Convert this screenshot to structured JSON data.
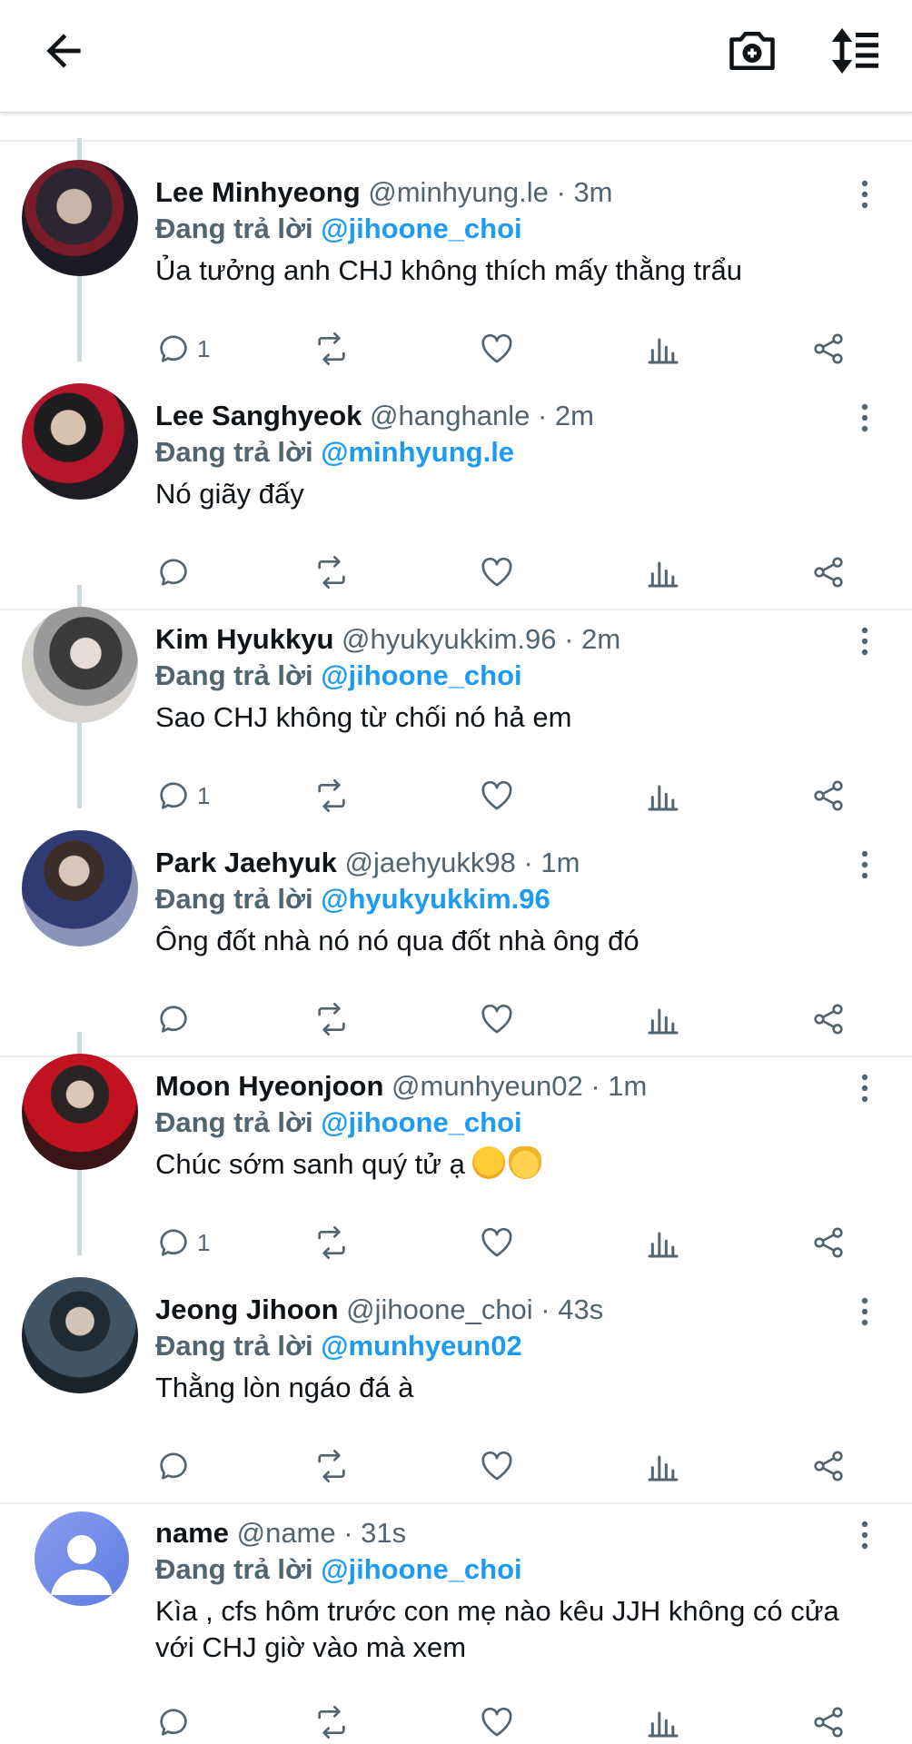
{
  "header": {
    "back_icon": "arrow-left-icon",
    "camera_icon": "camera-plus-icon",
    "sort_icon": "sort-list-icon"
  },
  "reply_prefix": "Đang trả lời",
  "tweets": [
    {
      "name": "Lee Minhyeong",
      "handle": "@minhyung.le · 3m",
      "mention": "@jihoone_choi",
      "text": "Ủa tưởng anh CHJ không thích mấy thằng trẩu",
      "reply_count": "1"
    },
    {
      "name": "Lee Sanghyeok",
      "handle": "@hanghanle · 2m",
      "mention": "@minhyung.le",
      "text": "Nó giãy đấy",
      "reply_count": ""
    },
    {
      "name": "Kim Hyukkyu",
      "handle": "@hyukyukkim.96 · 2m",
      "mention": "@jihoone_choi",
      "text": "Sao CHJ không từ chối nó hả em",
      "reply_count": "1"
    },
    {
      "name": "Park Jaehyuk",
      "handle": "@jaehyukk98 · 1m",
      "mention": "@hyukyukkim.96",
      "text": "Ông đốt nhà nó nó qua đốt nhà ông đó",
      "reply_count": ""
    },
    {
      "name": "Moon Hyeonjoon",
      "handle": "@munhyeun02 · 1m",
      "mention": "@jihoone_choi",
      "text": "Chúc sớm sanh quý tử ạ",
      "reply_count": "1"
    },
    {
      "name": "Jeong Jihoon",
      "handle": "@jihoone_choi · 43s",
      "mention": "@munhyeun02",
      "text": "Thằng lòn ngáo đá à",
      "reply_count": ""
    },
    {
      "name": "name",
      "handle": "@name · 31s",
      "mention": "@jihoone_choi",
      "text": "Kìa , cfs hôm trước con mẹ nào kêu JJH không có cửa với CHJ giờ vào mà xem",
      "reply_count": ""
    }
  ],
  "colors": {
    "accent": "#1d9bf0",
    "muted": "#536471",
    "text": "#0f1419"
  }
}
